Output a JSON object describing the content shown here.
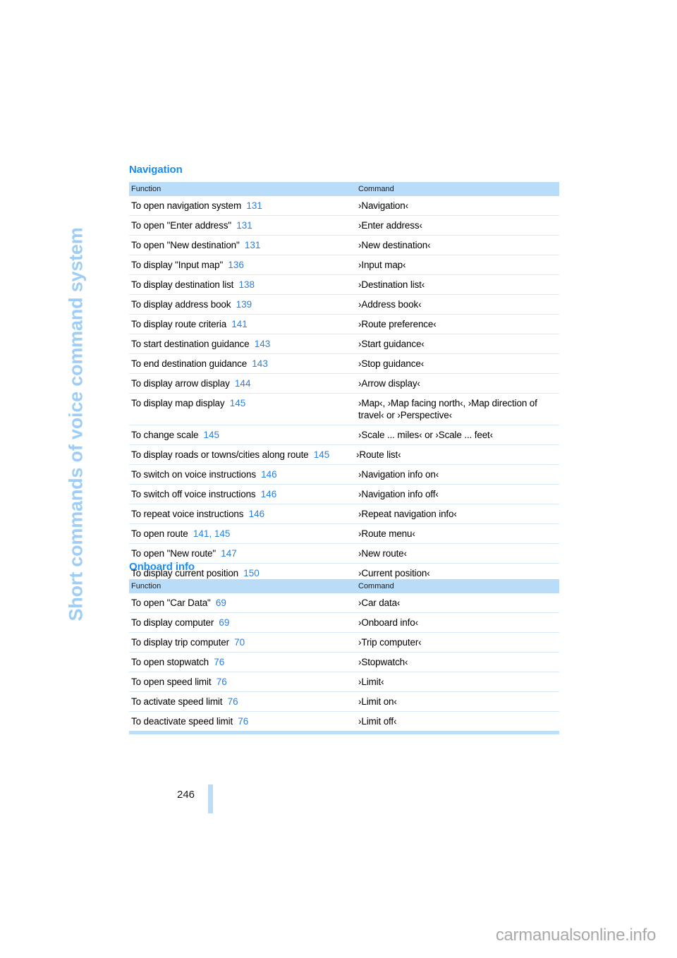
{
  "side_title": "Short commands of voice command system",
  "folio": {
    "page_number": "246"
  },
  "watermark": "carmanualsonline.info",
  "colors": {
    "heading_blue": "#1a8cf0",
    "side_title_blue": "#9ecdf6",
    "table_header_bg": "#b9dcf8",
    "page_ref_blue": "#2b7fe0",
    "row_rule": "#d7e9f9"
  },
  "sections": [
    {
      "heading": "Navigation",
      "columns": {
        "function": "Function",
        "command": "Command"
      },
      "rows": [
        {
          "function": "To open navigation system",
          "page": "131",
          "command": "›Navigation‹"
        },
        {
          "function": "To open \"Enter address\"",
          "page": "131",
          "command": "›Enter address‹"
        },
        {
          "function": "To open \"New destination\"",
          "page": "131",
          "command": "›New destination‹"
        },
        {
          "function": "To display \"Input map\"",
          "page": "136",
          "command": "›Input map‹"
        },
        {
          "function": "To display destination list",
          "page": "138",
          "command": "›Destination list‹"
        },
        {
          "function": "To display address book",
          "page": "139",
          "command": "›Address book‹"
        },
        {
          "function": "To display route criteria",
          "page": "141",
          "command": "›Route preference‹"
        },
        {
          "function": "To start destination guidance",
          "page": "143",
          "command": "›Start guidance‹"
        },
        {
          "function": "To end destination guidance",
          "page": "143",
          "command": "›Stop guidance‹"
        },
        {
          "function": "To display arrow display",
          "page": "144",
          "command": "›Arrow display‹"
        },
        {
          "function": "To display map display",
          "page": "145",
          "command": "›Map‹, ›Map facing north‹, ›Map direction of travel‹ or ›Perspective‹"
        },
        {
          "function": "To change scale",
          "page": "145",
          "command": "›Scale ... miles‹ or ›Scale ... feet‹"
        },
        {
          "function": "To display roads or towns/cities along route",
          "page": "145",
          "command": "›Route list‹",
          "wide": true
        },
        {
          "function": "To switch on voice instructions",
          "page": "146",
          "command": "›Navigation info on‹"
        },
        {
          "function": "To switch off voice instructions",
          "page": "146",
          "command": "›Navigation info off‹"
        },
        {
          "function": "To repeat voice instructions",
          "page": "146",
          "command": "›Repeat navigation info‹"
        },
        {
          "function": "To open route",
          "page": "141, 145",
          "command": "›Route menu‹"
        },
        {
          "function": "To open \"New route\"",
          "page": "147",
          "command": "›New route‹"
        },
        {
          "function": "To display current position",
          "page": "150",
          "command": "›Current position‹"
        }
      ]
    },
    {
      "heading": "Onboard info",
      "columns": {
        "function": "Function",
        "command": "Command"
      },
      "rows": [
        {
          "function": "To open \"Car Data\"",
          "page": "69",
          "command": "›Car data‹"
        },
        {
          "function": "To display computer",
          "page": "69",
          "command": "›Onboard info‹"
        },
        {
          "function": "To display trip computer",
          "page": "70",
          "command": "›Trip computer‹"
        },
        {
          "function": "To open stopwatch",
          "page": "76",
          "command": "›Stopwatch‹"
        },
        {
          "function": "To open speed limit",
          "page": "76",
          "command": "›Limit‹"
        },
        {
          "function": "To activate speed limit",
          "page": "76",
          "command": "›Limit on‹"
        },
        {
          "function": "To deactivate speed limit",
          "page": "76",
          "command": "›Limit off‹"
        }
      ]
    }
  ]
}
